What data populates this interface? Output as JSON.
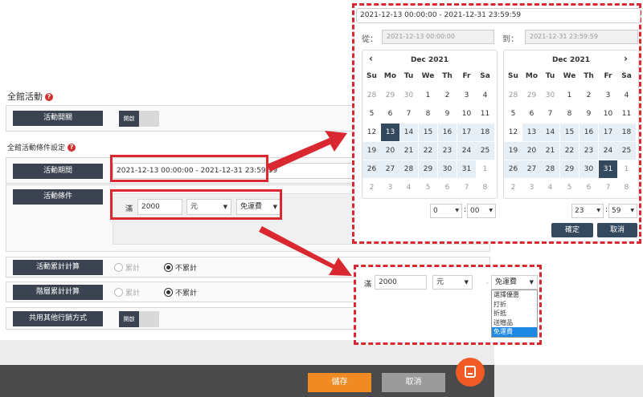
{
  "form": {
    "section1_title": "全館活動",
    "section2_title": "全館活動條件設定",
    "rows": {
      "enable": {
        "label": "活動開關",
        "toggle_text": "開啟"
      },
      "period": {
        "label": "活動期間",
        "value": "2021-12-13 00:00:00 - 2021-12-31 23:59:59"
      },
      "condition": {
        "label": "活動條件",
        "prefix": "滿",
        "amount": "2000",
        "unit": "元",
        "benefit": "免運費"
      },
      "accumulate": {
        "label": "活動累計計算",
        "opt_yes": "累計",
        "opt_no": "不累計"
      },
      "tier": {
        "label": "階層累計計算",
        "opt_yes": "累計",
        "opt_no": "不累計"
      },
      "share": {
        "label": "共用其他行銷方式",
        "toggle_text": "開啟"
      }
    }
  },
  "footer": {
    "save": "儲存",
    "cancel": "取消"
  },
  "datepicker": {
    "range": "2021-12-13 00:00:00 - 2021-12-31 23:59:59",
    "from_label": "從：",
    "from_value": "2021-12-13 00:00:00",
    "to_label": "到：",
    "to_value": "2021-12-31 23:59:59",
    "weekdays": [
      "Su",
      "Mo",
      "Tu",
      "We",
      "Th",
      "Fr",
      "Sa"
    ],
    "left": {
      "month": "Dec 2021",
      "hour": "0",
      "minute": "00",
      "days": [
        [
          "28",
          "off"
        ],
        [
          "29",
          "off"
        ],
        [
          "30",
          "off"
        ],
        [
          "1",
          ""
        ],
        [
          "2",
          ""
        ],
        [
          "3",
          ""
        ],
        [
          "4",
          ""
        ],
        [
          "5",
          ""
        ],
        [
          "6",
          ""
        ],
        [
          "7",
          ""
        ],
        [
          "8",
          ""
        ],
        [
          "9",
          ""
        ],
        [
          "10",
          ""
        ],
        [
          "11",
          ""
        ],
        [
          "12",
          ""
        ],
        [
          "13",
          "sel"
        ],
        [
          "14",
          "inr"
        ],
        [
          "15",
          "inr"
        ],
        [
          "16",
          "inr"
        ],
        [
          "17",
          "inr"
        ],
        [
          "18",
          "inr"
        ],
        [
          "19",
          "inr"
        ],
        [
          "20",
          "inr"
        ],
        [
          "21",
          "inr"
        ],
        [
          "22",
          "inr"
        ],
        [
          "23",
          "inr"
        ],
        [
          "24",
          "inr"
        ],
        [
          "25",
          "inr"
        ],
        [
          "26",
          "inr"
        ],
        [
          "27",
          "inr"
        ],
        [
          "28",
          "inr"
        ],
        [
          "29",
          "inr"
        ],
        [
          "30",
          "inr"
        ],
        [
          "31",
          "inr"
        ],
        [
          "1",
          "off"
        ],
        [
          "2",
          "off"
        ],
        [
          "3",
          "off"
        ],
        [
          "4",
          "off"
        ],
        [
          "5",
          "off"
        ],
        [
          "6",
          "off"
        ],
        [
          "7",
          "off"
        ],
        [
          "8",
          "off"
        ]
      ]
    },
    "right": {
      "month": "Dec 2021",
      "hour": "23",
      "minute": "59",
      "days": [
        [
          "28",
          "off"
        ],
        [
          "29",
          "off"
        ],
        [
          "30",
          "off"
        ],
        [
          "1",
          ""
        ],
        [
          "2",
          ""
        ],
        [
          "3",
          ""
        ],
        [
          "4",
          ""
        ],
        [
          "5",
          ""
        ],
        [
          "6",
          ""
        ],
        [
          "7",
          ""
        ],
        [
          "8",
          ""
        ],
        [
          "9",
          ""
        ],
        [
          "10",
          ""
        ],
        [
          "11",
          ""
        ],
        [
          "12",
          ""
        ],
        [
          "13",
          "inr"
        ],
        [
          "14",
          "inr"
        ],
        [
          "15",
          "inr"
        ],
        [
          "16",
          "inr"
        ],
        [
          "17",
          "inr"
        ],
        [
          "18",
          "inr"
        ],
        [
          "19",
          "inr"
        ],
        [
          "20",
          "inr"
        ],
        [
          "21",
          "inr"
        ],
        [
          "22",
          "inr"
        ],
        [
          "23",
          "inr"
        ],
        [
          "24",
          "inr"
        ],
        [
          "25",
          "inr"
        ],
        [
          "26",
          "inr"
        ],
        [
          "27",
          "inr"
        ],
        [
          "28",
          "inr"
        ],
        [
          "29",
          "inr"
        ],
        [
          "30",
          "inr"
        ],
        [
          "31",
          "sel"
        ],
        [
          "1",
          "off"
        ],
        [
          "2",
          "off"
        ],
        [
          "3",
          "off"
        ],
        [
          "4",
          "off"
        ],
        [
          "5",
          "off"
        ],
        [
          "6",
          "off"
        ],
        [
          "7",
          "off"
        ],
        [
          "8",
          "off"
        ]
      ]
    },
    "ok": "確定",
    "cancel": "取消"
  },
  "dropdown": {
    "prefix": "滿",
    "amount": "2000",
    "unit": "元",
    "selected": "免運費",
    "options": [
      "選擇優惠",
      "打折",
      "折抵",
      "送贈品",
      "免運費"
    ],
    "highlighted_index": 4
  },
  "colors": {
    "accent_red": "#d9282f",
    "label_dark": "#3b4350",
    "save_orange": "#f08a22"
  }
}
